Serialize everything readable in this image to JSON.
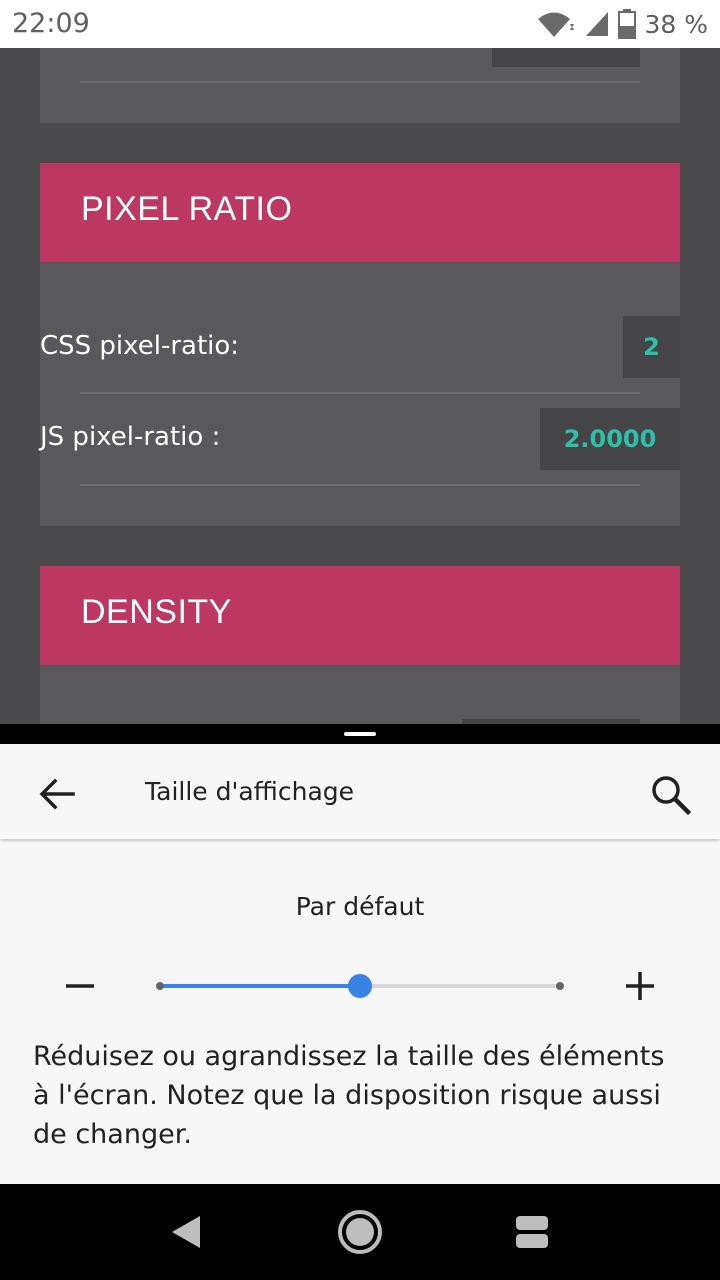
{
  "status_bar": {
    "time": "22:09",
    "battery_text": "38 %",
    "icons": [
      "wifi-icon",
      "cell-signal-icon",
      "battery-icon"
    ]
  },
  "web_page": {
    "sections": [
      {
        "title": "PIXEL RATIO",
        "rows": [
          {
            "label": "CSS pixel-ratio:",
            "value": "2"
          },
          {
            "label": "JS pixel-ratio :",
            "value": "2.0000"
          }
        ]
      },
      {
        "title": "DENSITY",
        "rows": []
      }
    ],
    "colors": {
      "header": "#bc3862",
      "value_text": "#2fbfa6",
      "card": "#59585b",
      "background": "#4a4a4c"
    }
  },
  "settings": {
    "title": "Taille d'affichage",
    "preview_label": "Par défaut",
    "slider": {
      "steps": 3,
      "selected_index": 1,
      "accent": "#3b82e6"
    },
    "description": "Réduisez ou agrandissez la taille des éléments à l'écran. Notez que la disposition risque aussi de changer."
  },
  "nav_bar": {
    "icons": [
      "back-triangle-icon",
      "home-circle-icon",
      "recents-icon"
    ]
  }
}
